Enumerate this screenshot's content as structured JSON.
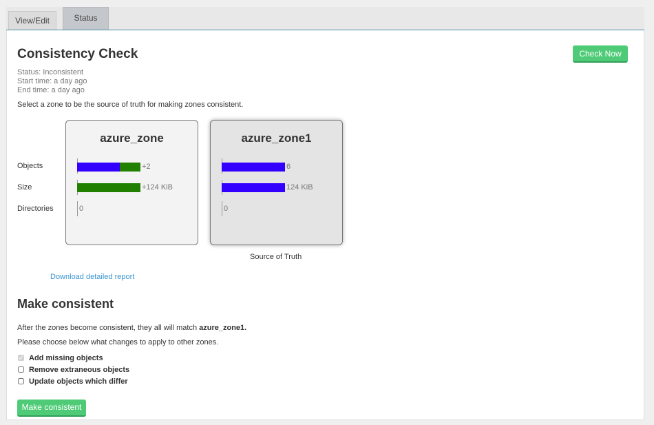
{
  "tabs": [
    {
      "label": "View/Edit"
    },
    {
      "label": "Status"
    }
  ],
  "consistency": {
    "title": "Consistency Check",
    "check_now_label": "Check Now",
    "status": "Status: Inconsistent",
    "start_time": "Start time: a day ago",
    "end_time": "End time: a day ago",
    "select_note": "Select a zone to be the source of truth for making zones consistent.",
    "row_labels": {
      "objects": "Objects",
      "size": "Size",
      "directories": "Directories"
    }
  },
  "zones": [
    {
      "name": "azure_zone",
      "selected": false,
      "objects": {
        "label": "+2",
        "common_fraction": 0.67,
        "diff_fraction": 0.33
      },
      "size": {
        "label": "+124 KiB",
        "common_fraction": 0,
        "diff_fraction": 1.0
      },
      "directories": {
        "label": "0"
      }
    },
    {
      "name": "azure_zone1",
      "selected": true,
      "objects": {
        "label": "6",
        "common_fraction": 1.0,
        "diff_fraction": 0
      },
      "size": {
        "label": "124 KiB",
        "common_fraction": 1.0,
        "diff_fraction": 0
      },
      "directories": {
        "label": "0"
      }
    }
  ],
  "source_of_truth_label": "Source of Truth",
  "download_report_label": "Download detailed report",
  "make_consistent": {
    "title": "Make consistent",
    "match_text_prefix": "After the zones become consistent, they all will match ",
    "match_zone": "azure_zone1.",
    "choose_text": "Please choose below what changes to apply to other zones.",
    "options": [
      {
        "label": "Add missing objects",
        "checked": true,
        "disabled": true
      },
      {
        "label": "Remove extraneous objects",
        "checked": false,
        "disabled": false
      },
      {
        "label": "Update objects which differ",
        "checked": false,
        "disabled": false
      }
    ],
    "button_label": "Make consistent"
  },
  "colors": {
    "common_bar": "#3300ff",
    "diff_bar": "#218000",
    "button_green": "#4fcb77",
    "link": "#3a95d0"
  }
}
